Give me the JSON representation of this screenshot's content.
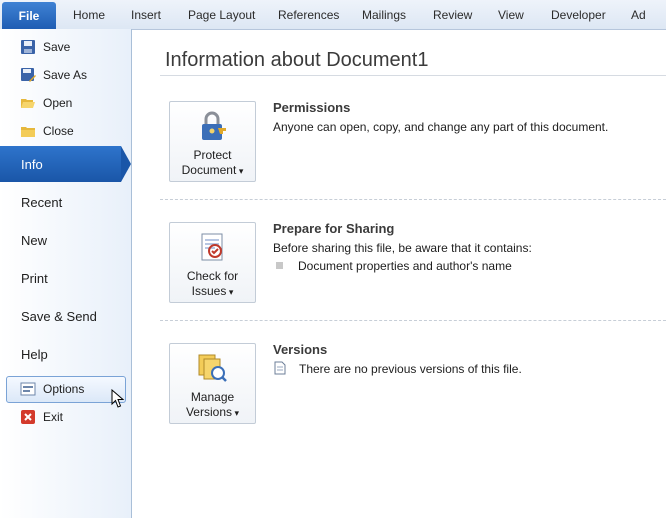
{
  "ribbon": {
    "file_tab": "File",
    "tabs": [
      "Home",
      "Insert",
      "Page Layout",
      "References",
      "Mailings",
      "Review",
      "View",
      "Developer",
      "Ad"
    ]
  },
  "backstage": {
    "commands": [
      "Save",
      "Save As",
      "Open",
      "Close"
    ],
    "nav": {
      "info": "Info",
      "recent": "Recent",
      "new": "New",
      "print": "Print",
      "save_send": "Save & Send",
      "help": "Help"
    },
    "bottom": {
      "options": "Options",
      "exit": "Exit"
    }
  },
  "main": {
    "title": "Information about Document1",
    "permissions": {
      "button_line1": "Protect",
      "button_line2": "Document",
      "heading": "Permissions",
      "text": "Anyone can open, copy, and change any part of this document."
    },
    "sharing": {
      "button_line1": "Check for",
      "button_line2": "Issues",
      "heading": "Prepare for Sharing",
      "text": "Before sharing this file, be aware that it contains:",
      "bullet": "Document properties and author's name"
    },
    "versions": {
      "button_line1": "Manage",
      "button_line2": "Versions",
      "heading": "Versions",
      "text": "There are no previous versions of this file."
    }
  },
  "colors": {
    "accent": "#1f5db3",
    "selected_nav": "#2e74cc"
  }
}
